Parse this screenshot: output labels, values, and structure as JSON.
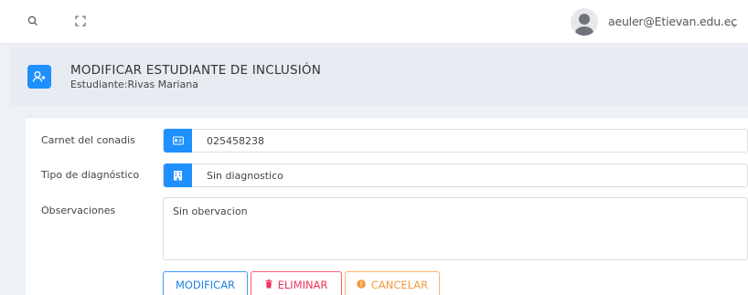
{
  "topbar": {
    "user_email": "aeuler@Etievan.edu.ec"
  },
  "header": {
    "title": "MODIFICAR ESTUDIANTE DE INCLUSIÓN",
    "subtitle": "Estudiante:Rivas Mariana"
  },
  "form": {
    "fields": [
      {
        "label": "Carnet del conadis",
        "value": "025458238",
        "icon": "id-card-icon"
      },
      {
        "label": "Tipo de diagnóstico",
        "value": "Sin diagnostico",
        "icon": "building-icon"
      }
    ],
    "observations": {
      "label": "Observaciones",
      "value": "Sin obervacion"
    }
  },
  "buttons": {
    "modify": "MODIFICAR",
    "delete": "ELIMINAR",
    "cancel": "CANCELAR"
  },
  "colors": {
    "primary": "#1e90ff",
    "danger": "#f0325a",
    "warning": "#f39a3d"
  }
}
